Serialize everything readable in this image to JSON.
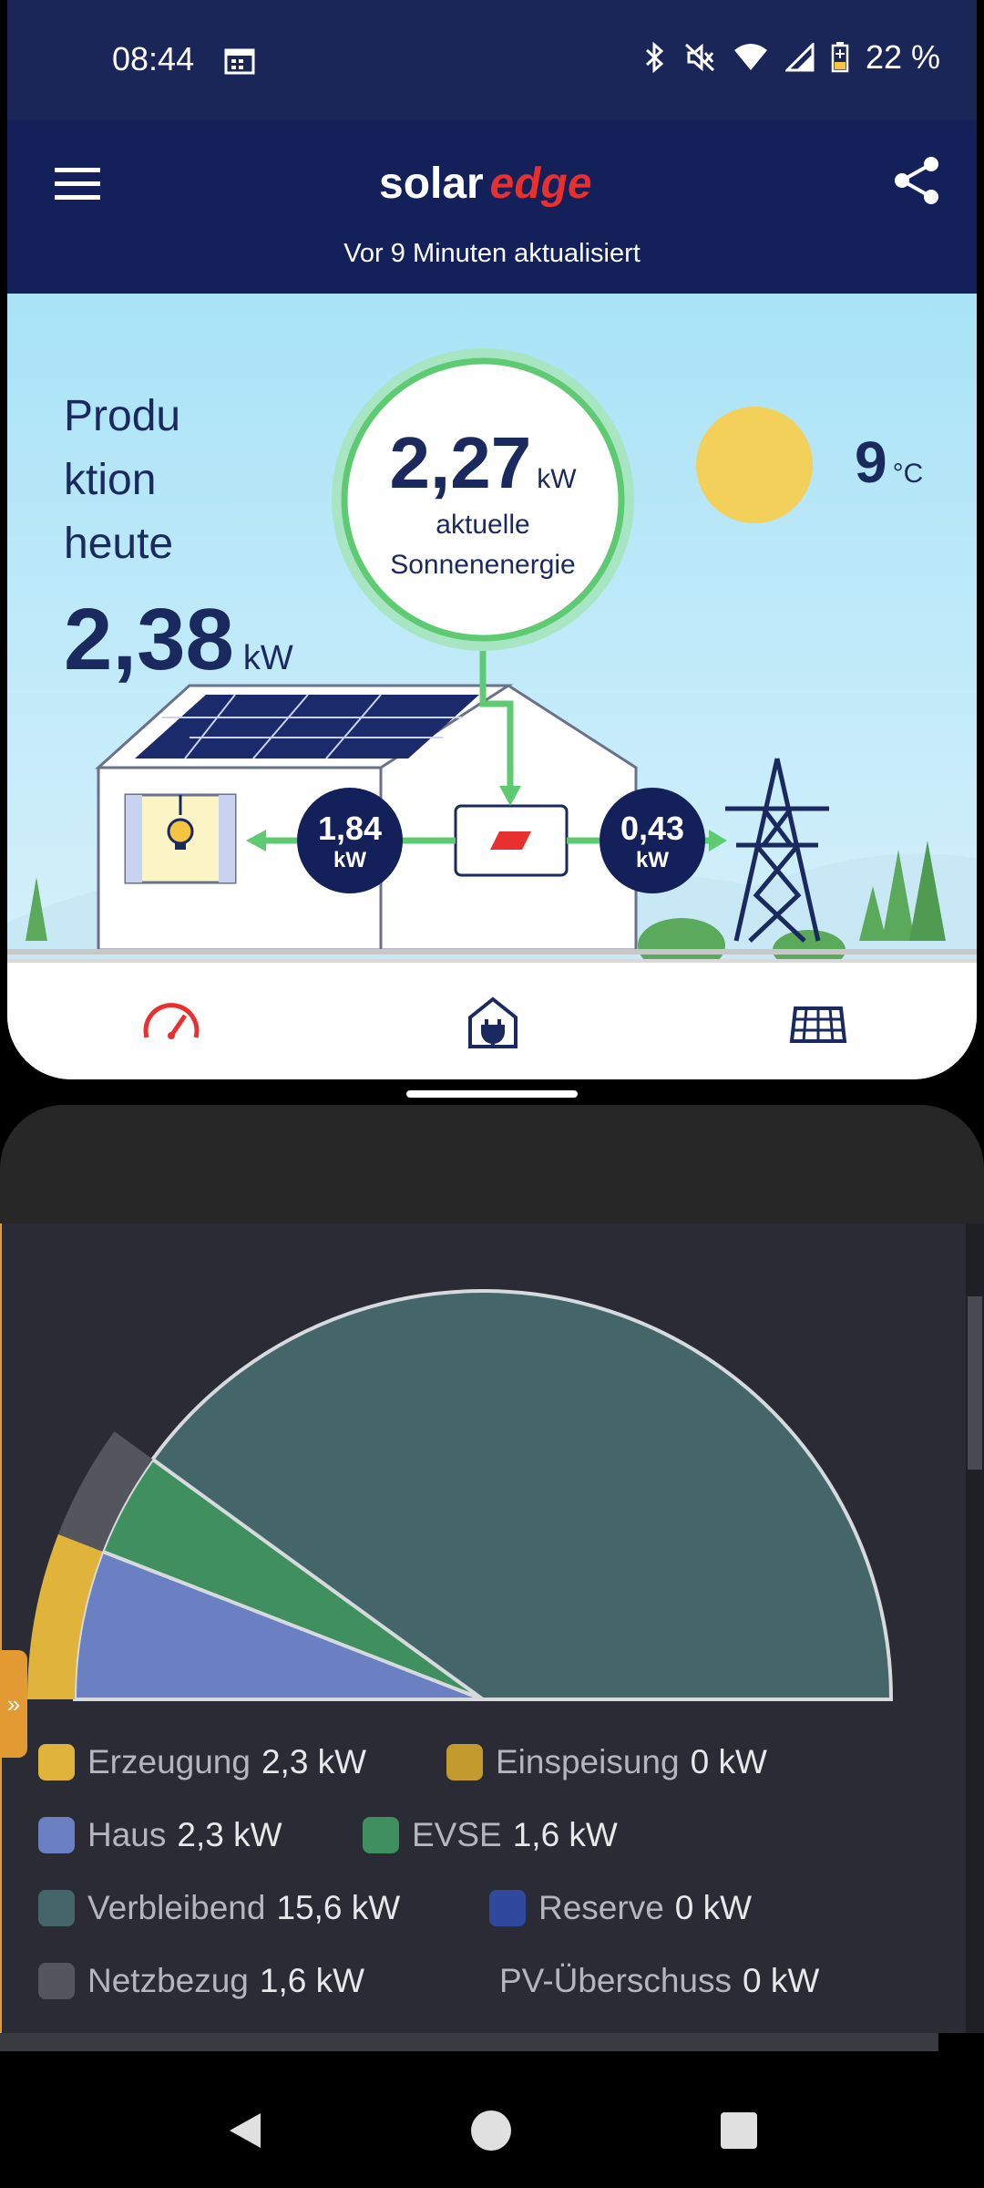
{
  "status_bar": {
    "time": "08:44",
    "battery": "22 %",
    "icons": [
      "calendar-icon",
      "bluetooth-icon",
      "mute-icon",
      "wifi-icon",
      "signal-icon",
      "battery-icon"
    ]
  },
  "app": {
    "logo_text_left": "solar",
    "logo_text_right": "edge",
    "updated": "Vor 9 Minuten aktualisiert",
    "production": {
      "label": "Produ ktion heute",
      "label_lines": [
        "Produ",
        "ktion",
        "heute"
      ],
      "value": "2,38",
      "unit": "kW"
    },
    "current": {
      "value": "2,27",
      "unit": "kW",
      "label_line1": "aktuelle",
      "label_line2": "Sonnenenergie"
    },
    "temperature": {
      "value": "9",
      "unit": "°C"
    },
    "flows": {
      "house": {
        "value": "1,84",
        "unit": "kW"
      },
      "grid": {
        "value": "0,43",
        "unit": "kW"
      }
    },
    "nav": [
      "dashboard-icon",
      "smart-home-icon",
      "layout-icon"
    ],
    "colors": {
      "header": "#14205a",
      "accent": "#e8312f",
      "flow": "#5ecb72"
    }
  },
  "widget": {
    "side_tab": "»",
    "chart_data": {
      "type": "pie",
      "subtype": "half-donut-gauge",
      "slices": [
        {
          "name": "Haus",
          "value": 2.3,
          "color": "#6a80c2"
        },
        {
          "name": "EVSE",
          "value": 1.6,
          "color": "#3f8f5f"
        },
        {
          "name": "Verbleibend",
          "value": 15.6,
          "color": "#456668"
        }
      ],
      "outer_ring": [
        {
          "name": "Erzeugung",
          "value": 2.3,
          "color": "#e0b33a"
        },
        {
          "name": "Netzbezug",
          "value": 1.6,
          "color": "#55555d"
        }
      ]
    },
    "legend": [
      {
        "name": "Erzeugung",
        "value": "2,3 kW",
        "color": "#e0b33a"
      },
      {
        "name": "Einspeisung",
        "value": "0 kW",
        "color": "#c29a2e"
      },
      {
        "name": "Haus",
        "value": "2,3 kW",
        "color": "#6a80c2"
      },
      {
        "name": "EVSE",
        "value": "1,6 kW",
        "color": "#3f8f5f"
      },
      {
        "name": "Verbleibend",
        "value": "15,6 kW",
        "color": "#456668"
      },
      {
        "name": "Reserve",
        "value": "0 kW",
        "color": "#2f4a9c"
      },
      {
        "name": "Netzbezug",
        "value": "1,6 kW",
        "color": "#55555d"
      },
      {
        "name": "PV-Überschuss",
        "value": "0 kW",
        "color": ""
      }
    ]
  },
  "system_nav": [
    "back-icon",
    "home-icon",
    "recents-icon"
  ]
}
